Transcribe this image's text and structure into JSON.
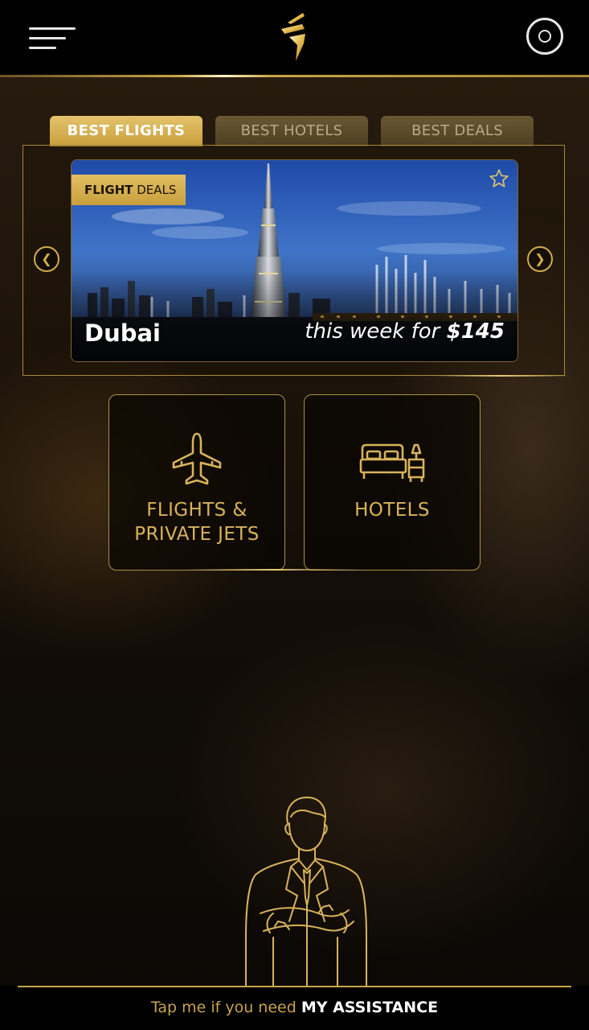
{
  "header": {
    "menu_icon": "hamburger-menu-icon",
    "logo": "brand-logo",
    "profile_icon": "profile-circle-icon"
  },
  "tabs": [
    {
      "label": "BEST FLIGHTS",
      "active": true
    },
    {
      "label": "BEST HOTELS",
      "active": false
    },
    {
      "label": "BEST DEALS",
      "active": false
    }
  ],
  "carousel": {
    "badge_bold": "FLIGHT",
    "badge_rest": " DEALS",
    "city": "Dubai",
    "price_prefix": "this week for ",
    "price": "$145",
    "favorite_icon": "star-outline-icon",
    "prev_icon": "chevron-left-icon",
    "next_icon": "chevron-right-icon"
  },
  "services": [
    {
      "label": "FLIGHTS &\nPRIVATE JETS",
      "icon": "airplane-icon"
    },
    {
      "label": "HOTELS",
      "icon": "bed-icon"
    }
  ],
  "assistant": {
    "text_prefix": "Tap me if you need ",
    "text_bold": "MY ASSISTANCE",
    "icon": "assistant-figure-icon"
  },
  "colors": {
    "gold": "#c9a34a",
    "gold_light": "#e4c36b",
    "background": "#000000"
  }
}
